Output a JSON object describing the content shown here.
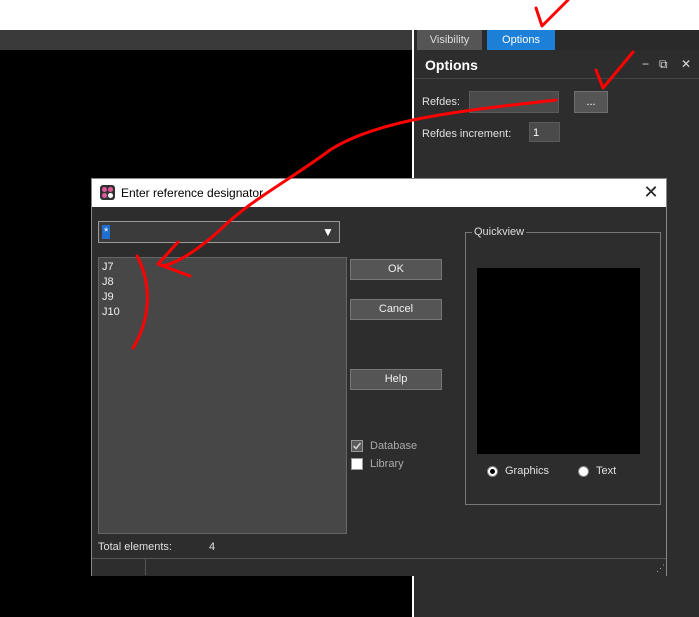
{
  "tabs": {
    "visibility": "Visibility",
    "options": "Options"
  },
  "panel": {
    "title": "Options",
    "minimize": "−",
    "restore": "⧉",
    "close": "✕",
    "refdes_label": "Refdes:",
    "refdes_value": "",
    "browse_label": "...",
    "increment_label": "Refdes increment:",
    "increment_value": "1"
  },
  "dialog": {
    "title": "Enter reference designator",
    "close": "✕",
    "combo_value": "*",
    "list_items": [
      "J7",
      "J8",
      "J9",
      "J10"
    ],
    "ok": "OK",
    "cancel": "Cancel",
    "help": "Help",
    "database": "Database",
    "database_checked": true,
    "library": "Library",
    "library_checked": false,
    "quickview": "Quickview",
    "graphics": "Graphics",
    "text": "Text",
    "selected_view": "Graphics",
    "total_label": "Total elements:",
    "total_value": "4"
  },
  "colors": {
    "accent": "#1c7fd8",
    "annotation": "#ff0000",
    "panel_bg": "#2d2d2d"
  },
  "icons": [
    "minimize-icon",
    "restore-icon",
    "close-icon",
    "dropdown-arrow-icon",
    "checkmark-icon",
    "app-icon",
    "resize-grip-icon"
  ]
}
